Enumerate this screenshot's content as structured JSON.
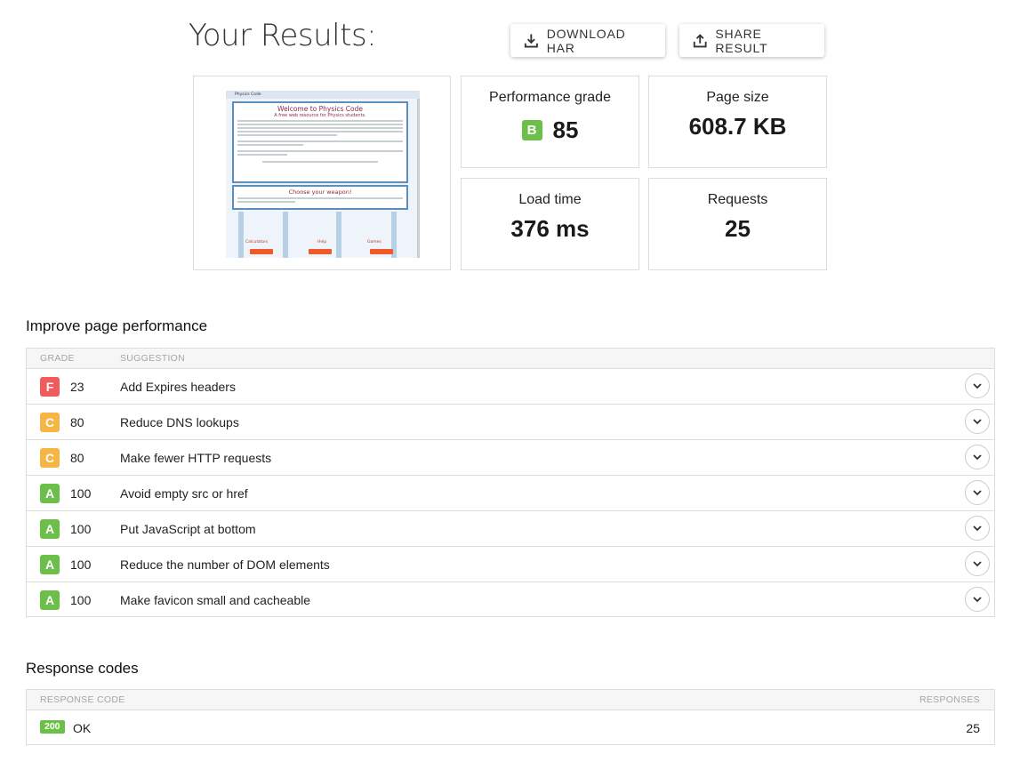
{
  "header": {
    "title": "Your Results:",
    "download_label": "DOWNLOAD HAR",
    "share_label": "SHARE RESULT"
  },
  "screenshot": {
    "site_title": "Physics Code",
    "heading": "Welcome to Physics Code",
    "subheading": "A free web resource for Physics students.",
    "section_heading": "Choose your weapon!",
    "calc_label": "Calculators",
    "help_label": "Help",
    "games_label": "Games"
  },
  "metrics": {
    "grade": {
      "label": "Performance grade",
      "letter": "B",
      "value": "85"
    },
    "page_size": {
      "label": "Page size",
      "value": "608.7 KB"
    },
    "load_time": {
      "label": "Load time",
      "value": "376 ms"
    },
    "requests": {
      "label": "Requests",
      "value": "25"
    }
  },
  "improve": {
    "title": "Improve page performance",
    "col_grade": "GRADE",
    "col_suggestion": "SUGGESTION",
    "rows": [
      {
        "letter": "F",
        "score": "23",
        "text": "Add Expires headers",
        "color": "#f25b5b"
      },
      {
        "letter": "C",
        "score": "80",
        "text": "Reduce DNS lookups",
        "color": "#f7b544"
      },
      {
        "letter": "C",
        "score": "80",
        "text": "Make fewer HTTP requests",
        "color": "#f7b544"
      },
      {
        "letter": "A",
        "score": "100",
        "text": "Avoid empty src or href",
        "color": "#6cc04a"
      },
      {
        "letter": "A",
        "score": "100",
        "text": "Put JavaScript at bottom",
        "color": "#6cc04a"
      },
      {
        "letter": "A",
        "score": "100",
        "text": "Reduce the number of DOM elements",
        "color": "#6cc04a"
      },
      {
        "letter": "A",
        "score": "100",
        "text": "Make favicon small and cacheable",
        "color": "#6cc04a"
      }
    ]
  },
  "responses": {
    "title": "Response codes",
    "col_code": "RESPONSE CODE",
    "col_count": "RESPONSES",
    "rows": [
      {
        "code": "200",
        "text": "OK",
        "count": "25"
      }
    ]
  }
}
